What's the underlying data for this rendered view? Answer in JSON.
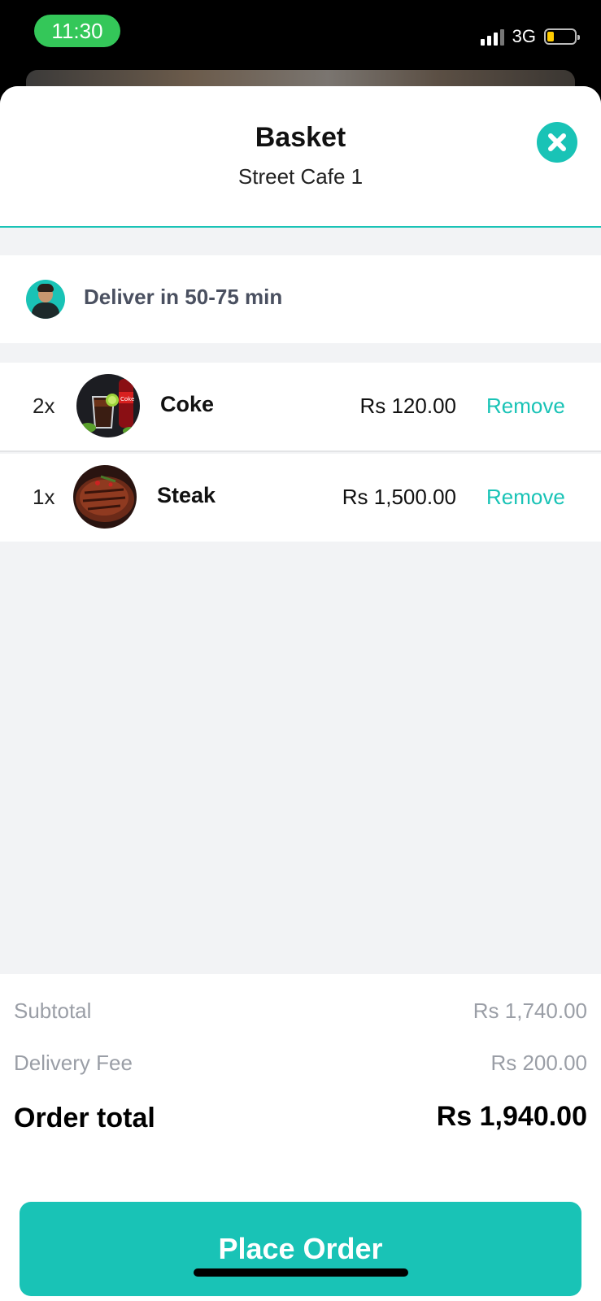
{
  "status_bar": {
    "time": "11:30",
    "network": "3G",
    "battery_level": 0.25
  },
  "header": {
    "title": "Basket",
    "subtitle": "Street Cafe 1",
    "close_icon": "close-circle-icon"
  },
  "delivery": {
    "text": "Deliver in 50-75 min",
    "avatar_icon": "driver-avatar"
  },
  "items": [
    {
      "qty": "2x",
      "name": "Coke",
      "price": "Rs 120.00",
      "remove_label": "Remove"
    },
    {
      "qty": "1x",
      "name": "Steak",
      "price": "Rs 1,500.00",
      "remove_label": "Remove"
    }
  ],
  "summary": {
    "subtotal_label": "Subtotal",
    "subtotal_value": "Rs 1,740.00",
    "delivery_fee_label": "Delivery Fee",
    "delivery_fee_value": "Rs 200.00",
    "total_label": "Order total",
    "total_value": "Rs 1,940.00"
  },
  "cta": {
    "place_order_label": "Place Order"
  },
  "colors": {
    "accent": "#19c3b6",
    "status_green": "#34c759",
    "battery_yellow": "#ffcc00"
  }
}
